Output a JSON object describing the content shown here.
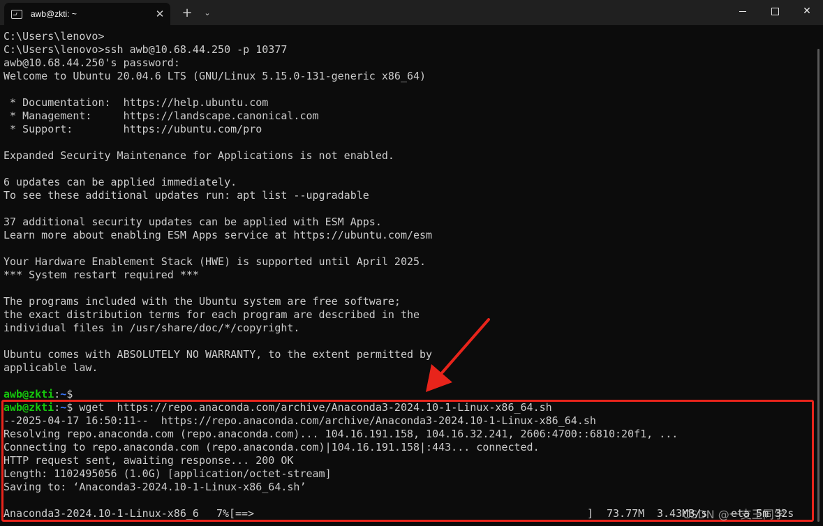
{
  "window": {
    "tab_title": "awb@zkti: ~",
    "tab_close": "✕",
    "new_tab": "+",
    "dropdown": "⌄",
    "close_glyph": "✕"
  },
  "terminal": {
    "lines": [
      "C:\\Users\\lenovo>",
      "C:\\Users\\lenovo>ssh awb@10.68.44.250 -p 10377",
      "awb@10.68.44.250's password:",
      "Welcome to Ubuntu 20.04.6 LTS (GNU/Linux 5.15.0-131-generic x86_64)",
      "",
      " * Documentation:  https://help.ubuntu.com",
      " * Management:     https://landscape.canonical.com",
      " * Support:        https://ubuntu.com/pro",
      "",
      "Expanded Security Maintenance for Applications is not enabled.",
      "",
      "6 updates can be applied immediately.",
      "To see these additional updates run: apt list --upgradable",
      "",
      "37 additional security updates can be applied with ESM Apps.",
      "Learn more about enabling ESM Apps service at https://ubuntu.com/esm",
      "",
      "Your Hardware Enablement Stack (HWE) is supported until April 2025.",
      "*** System restart required ***",
      "",
      "The programs included with the Ubuntu system are free software;",
      "the exact distribution terms for each program are described in the",
      "individual files in /usr/share/doc/*/copyright.",
      "",
      "Ubuntu comes with ABSOLUTELY NO WARRANTY, to the extent permitted by",
      "applicable law.",
      ""
    ],
    "prompt": {
      "user": "awb@zkti",
      "colon": ":",
      "path": "~",
      "dollar": "$"
    },
    "command": " wget  https://repo.anaconda.com/archive/Anaconda3-2024.10-1-Linux-x86_64.sh",
    "output": [
      "--2025-04-17 16:50:11--  https://repo.anaconda.com/archive/Anaconda3-2024.10-1-Linux-x86_64.sh",
      "Resolving repo.anaconda.com (repo.anaconda.com)... 104.16.191.158, 104.16.32.241, 2606:4700::6810:20f1, ...",
      "Connecting to repo.anaconda.com (repo.anaconda.com)|104.16.191.158|:443... connected.",
      "HTTP request sent, awaiting response... 200 OK",
      "Length: 1102495056 (1.0G) [application/octet-stream]",
      "Saving to: ‘Anaconda3-2024.10-1-Linux-x86_64.sh’",
      ""
    ],
    "progress": {
      "file": "Anaconda3-2024.10-1-Linux-x86_6",
      "percent": "7%",
      "bar_open": "[",
      "bar_fill": "==>",
      "bar_close": "]",
      "size": "73.77M",
      "speed": "3.43MB/s",
      "eta": "eta 5m 32s"
    }
  },
  "watermark": "CSDN @一支王同学",
  "colors": {
    "background": "#0c0c0c",
    "prompt_user": "#16c60c",
    "prompt_path": "#3b78ff",
    "highlight": "#e8241b"
  }
}
